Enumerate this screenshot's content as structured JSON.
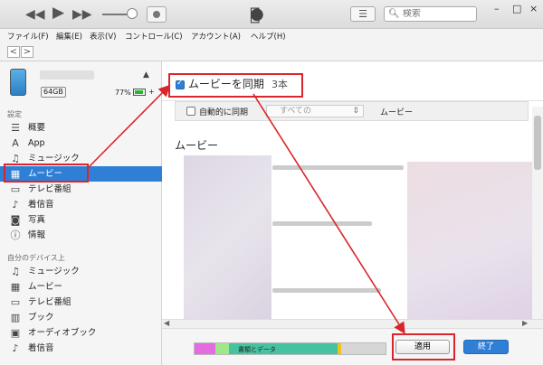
{
  "titlebar": {
    "controls": {
      "rewind": "◀◀",
      "play": "▶",
      "forward": "▶▶"
    },
    "search_placeholder": "検索",
    "window_buttons": {
      "minimize": "–",
      "maximize": "□",
      "close": "×"
    },
    "icons": [
      "rewind-icon",
      "play-icon",
      "forward-icon",
      "airplay-icon",
      "apple-logo-icon",
      "list-view-icon",
      "search-icon"
    ]
  },
  "menu": {
    "items": [
      "ファイル(F)",
      "編集(E)",
      "表示(V)",
      "コントロール(C)",
      "アカウント(A)",
      "ヘルプ(H)"
    ]
  },
  "nav": {
    "back": "<",
    "forward": ">"
  },
  "device": {
    "capacity": "64GB",
    "battery": "77%",
    "battery_color": "#2ab52a",
    "eject": "▲",
    "plug": "+"
  },
  "sidebar": {
    "settings_header": "設定",
    "settings_items": [
      {
        "icon": "summary-icon",
        "glyph": "☰",
        "label": "概要"
      },
      {
        "icon": "app-icon",
        "glyph": "A",
        "label": "App"
      },
      {
        "icon": "music-icon",
        "glyph": "♫",
        "label": "ミュージック"
      },
      {
        "icon": "movie-icon",
        "glyph": "▦",
        "label": "ムービー"
      },
      {
        "icon": "tv-icon",
        "glyph": "▭",
        "label": "テレビ番組"
      },
      {
        "icon": "bell-icon",
        "glyph": "♪",
        "label": "着信音"
      },
      {
        "icon": "camera-icon",
        "glyph": "◙",
        "label": "写真"
      },
      {
        "icon": "info-icon",
        "glyph": "ⓘ",
        "label": "情報"
      }
    ],
    "device_header": "自分のデバイス上",
    "device_items": [
      {
        "icon": "music-icon",
        "glyph": "♫",
        "label": "ミュージック"
      },
      {
        "icon": "movie-icon",
        "glyph": "▦",
        "label": "ムービー"
      },
      {
        "icon": "tv-icon",
        "glyph": "▭",
        "label": "テレビ番組"
      },
      {
        "icon": "book-icon",
        "glyph": "▥",
        "label": "ブック"
      },
      {
        "icon": "audiobook-icon",
        "glyph": "▣",
        "label": "オーディオブック"
      },
      {
        "icon": "bell-icon",
        "glyph": "♪",
        "label": "着信音"
      }
    ],
    "active_color": "#2f7fd6"
  },
  "main": {
    "sync_label": "ムービーを同期",
    "sync_count": "3本",
    "auto_label": "自動的に同期",
    "auto_select": "すべての",
    "auto_suffix": "ムービー",
    "movies_title": "ムービー"
  },
  "bottom": {
    "capacity_label": "書類とデータ",
    "segments": [
      {
        "name": "photos",
        "color": "#e56be0",
        "fraction": 0.11
      },
      {
        "name": "apps",
        "color": "#9fe88a",
        "fraction": 0.07
      },
      {
        "name": "documents",
        "color": "#45c2a0",
        "fraction": 0.57
      },
      {
        "name": "other",
        "color": "#f0c419",
        "fraction": 0.02
      },
      {
        "name": "free",
        "color": "#d6d6d6",
        "fraction": 0.23
      }
    ],
    "apply": "適用",
    "done": "終了"
  },
  "annotation_color": "#d9252b"
}
